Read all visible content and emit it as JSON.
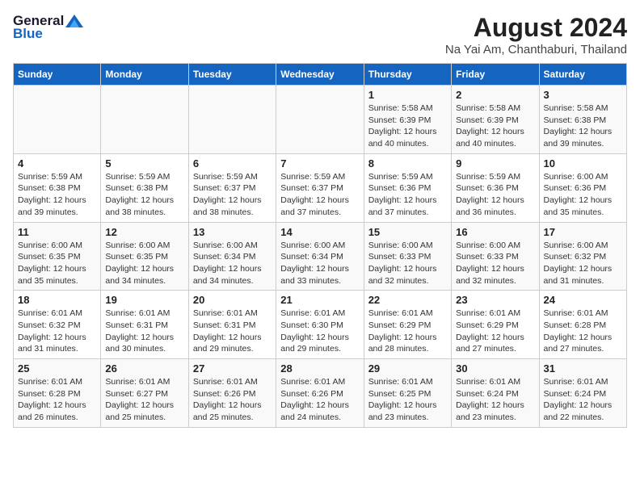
{
  "header": {
    "logo_general": "General",
    "logo_blue": "Blue",
    "main_title": "August 2024",
    "subtitle": "Na Yai Am, Chanthaburi, Thailand"
  },
  "calendar": {
    "days_of_week": [
      "Sunday",
      "Monday",
      "Tuesday",
      "Wednesday",
      "Thursday",
      "Friday",
      "Saturday"
    ],
    "weeks": [
      [
        {
          "day": "",
          "info": ""
        },
        {
          "day": "",
          "info": ""
        },
        {
          "day": "",
          "info": ""
        },
        {
          "day": "",
          "info": ""
        },
        {
          "day": "1",
          "info": "Sunrise: 5:58 AM\nSunset: 6:39 PM\nDaylight: 12 hours\nand 40 minutes."
        },
        {
          "day": "2",
          "info": "Sunrise: 5:58 AM\nSunset: 6:39 PM\nDaylight: 12 hours\nand 40 minutes."
        },
        {
          "day": "3",
          "info": "Sunrise: 5:58 AM\nSunset: 6:38 PM\nDaylight: 12 hours\nand 39 minutes."
        }
      ],
      [
        {
          "day": "4",
          "info": "Sunrise: 5:59 AM\nSunset: 6:38 PM\nDaylight: 12 hours\nand 39 minutes."
        },
        {
          "day": "5",
          "info": "Sunrise: 5:59 AM\nSunset: 6:38 PM\nDaylight: 12 hours\nand 38 minutes."
        },
        {
          "day": "6",
          "info": "Sunrise: 5:59 AM\nSunset: 6:37 PM\nDaylight: 12 hours\nand 38 minutes."
        },
        {
          "day": "7",
          "info": "Sunrise: 5:59 AM\nSunset: 6:37 PM\nDaylight: 12 hours\nand 37 minutes."
        },
        {
          "day": "8",
          "info": "Sunrise: 5:59 AM\nSunset: 6:36 PM\nDaylight: 12 hours\nand 37 minutes."
        },
        {
          "day": "9",
          "info": "Sunrise: 5:59 AM\nSunset: 6:36 PM\nDaylight: 12 hours\nand 36 minutes."
        },
        {
          "day": "10",
          "info": "Sunrise: 6:00 AM\nSunset: 6:36 PM\nDaylight: 12 hours\nand 35 minutes."
        }
      ],
      [
        {
          "day": "11",
          "info": "Sunrise: 6:00 AM\nSunset: 6:35 PM\nDaylight: 12 hours\nand 35 minutes."
        },
        {
          "day": "12",
          "info": "Sunrise: 6:00 AM\nSunset: 6:35 PM\nDaylight: 12 hours\nand 34 minutes."
        },
        {
          "day": "13",
          "info": "Sunrise: 6:00 AM\nSunset: 6:34 PM\nDaylight: 12 hours\nand 34 minutes."
        },
        {
          "day": "14",
          "info": "Sunrise: 6:00 AM\nSunset: 6:34 PM\nDaylight: 12 hours\nand 33 minutes."
        },
        {
          "day": "15",
          "info": "Sunrise: 6:00 AM\nSunset: 6:33 PM\nDaylight: 12 hours\nand 32 minutes."
        },
        {
          "day": "16",
          "info": "Sunrise: 6:00 AM\nSunset: 6:33 PM\nDaylight: 12 hours\nand 32 minutes."
        },
        {
          "day": "17",
          "info": "Sunrise: 6:00 AM\nSunset: 6:32 PM\nDaylight: 12 hours\nand 31 minutes."
        }
      ],
      [
        {
          "day": "18",
          "info": "Sunrise: 6:01 AM\nSunset: 6:32 PM\nDaylight: 12 hours\nand 31 minutes."
        },
        {
          "day": "19",
          "info": "Sunrise: 6:01 AM\nSunset: 6:31 PM\nDaylight: 12 hours\nand 30 minutes."
        },
        {
          "day": "20",
          "info": "Sunrise: 6:01 AM\nSunset: 6:31 PM\nDaylight: 12 hours\nand 29 minutes."
        },
        {
          "day": "21",
          "info": "Sunrise: 6:01 AM\nSunset: 6:30 PM\nDaylight: 12 hours\nand 29 minutes."
        },
        {
          "day": "22",
          "info": "Sunrise: 6:01 AM\nSunset: 6:29 PM\nDaylight: 12 hours\nand 28 minutes."
        },
        {
          "day": "23",
          "info": "Sunrise: 6:01 AM\nSunset: 6:29 PM\nDaylight: 12 hours\nand 27 minutes."
        },
        {
          "day": "24",
          "info": "Sunrise: 6:01 AM\nSunset: 6:28 PM\nDaylight: 12 hours\nand 27 minutes."
        }
      ],
      [
        {
          "day": "25",
          "info": "Sunrise: 6:01 AM\nSunset: 6:28 PM\nDaylight: 12 hours\nand 26 minutes."
        },
        {
          "day": "26",
          "info": "Sunrise: 6:01 AM\nSunset: 6:27 PM\nDaylight: 12 hours\nand 25 minutes."
        },
        {
          "day": "27",
          "info": "Sunrise: 6:01 AM\nSunset: 6:26 PM\nDaylight: 12 hours\nand 25 minutes."
        },
        {
          "day": "28",
          "info": "Sunrise: 6:01 AM\nSunset: 6:26 PM\nDaylight: 12 hours\nand 24 minutes."
        },
        {
          "day": "29",
          "info": "Sunrise: 6:01 AM\nSunset: 6:25 PM\nDaylight: 12 hours\nand 23 minutes."
        },
        {
          "day": "30",
          "info": "Sunrise: 6:01 AM\nSunset: 6:24 PM\nDaylight: 12 hours\nand 23 minutes."
        },
        {
          "day": "31",
          "info": "Sunrise: 6:01 AM\nSunset: 6:24 PM\nDaylight: 12 hours\nand 22 minutes."
        }
      ]
    ]
  }
}
